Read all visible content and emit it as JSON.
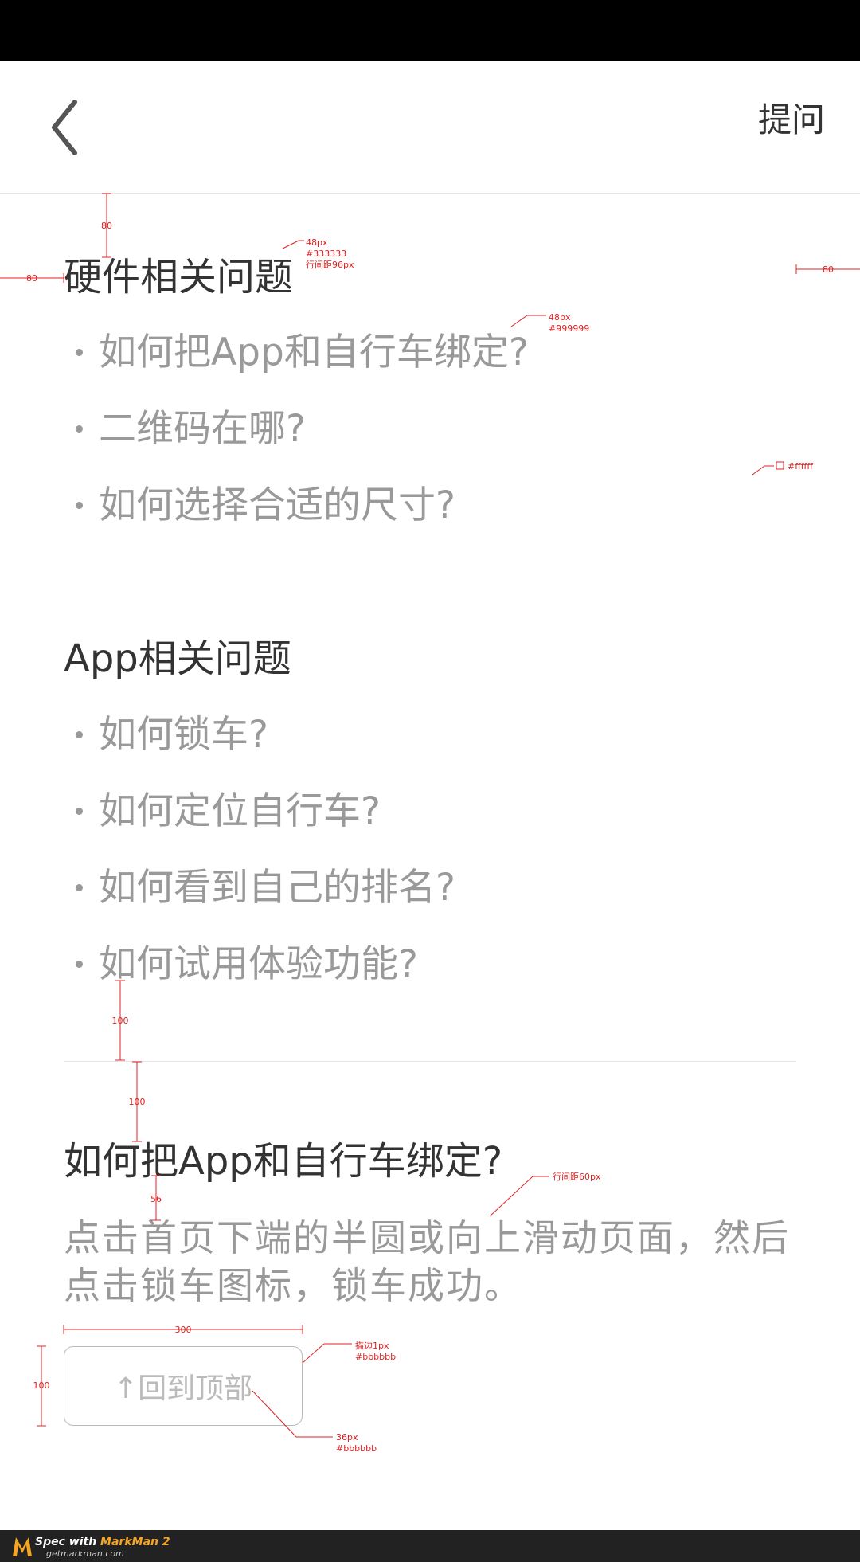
{
  "navbar": {
    "ask_label": "提问"
  },
  "sections": [
    {
      "title": "硬件相关问题",
      "questions": [
        "如何把App和自行车绑定?",
        "二维码在哪?",
        "如何选择合适的尺寸?"
      ]
    },
    {
      "title": "App相关问题",
      "questions": [
        "如何锁车?",
        "如何定位自行车?",
        "如何看到自己的排名?",
        "如何试用体验功能?"
      ]
    }
  ],
  "answer": {
    "title": "如何把App和自行车绑定?",
    "body": "点击首页下端的半圆或向上滑动页面，然后点击锁车图标，锁车成功。"
  },
  "back_to_top_label": "↑回到顶部",
  "annotations": {
    "top_gap": "80",
    "left_margin": "80",
    "right_margin": "80",
    "title_spec": [
      "48px",
      "#333333",
      "行间距96px"
    ],
    "question_spec": [
      "48px",
      "#999999"
    ],
    "bg_spec": "#ffffff",
    "after_list": "100",
    "after_divider": "100",
    "title_to_body": "56",
    "line_spacing": "行间距60px",
    "button_width": "300",
    "button_height": "100",
    "border_spec": [
      "描边1px",
      "#bbbbbb"
    ],
    "button_text_spec": [
      "36px",
      "#bbbbbb"
    ]
  },
  "footer": {
    "brand_prefix": "Spec with",
    "brand_name": "MarkMan 2",
    "site": "getmarkman.com"
  },
  "colors": {
    "title": "#333333",
    "question": "#999999",
    "button": "#bbbbbb",
    "annotation": "#e02020",
    "status_bar": "#000000"
  }
}
